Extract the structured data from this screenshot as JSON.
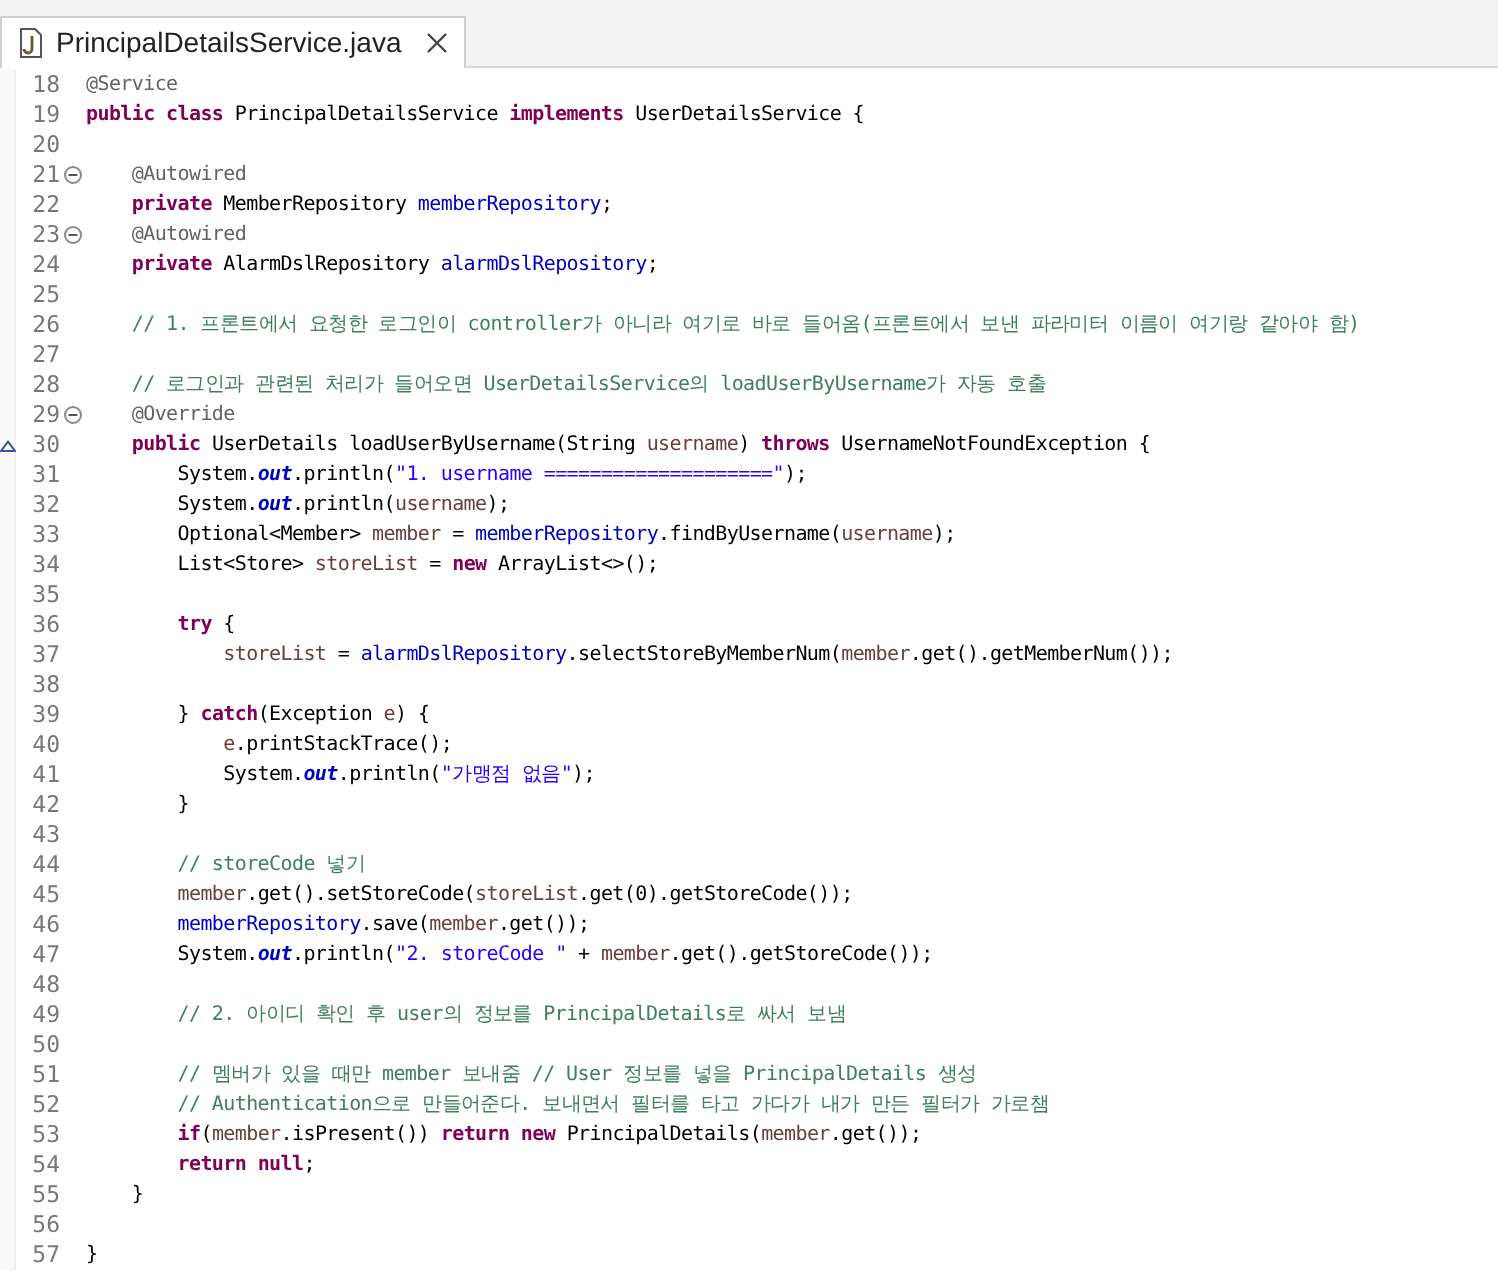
{
  "tabs": [
    {
      "label": "PrincipalDetailsService.java",
      "selected": true
    }
  ],
  "editor": {
    "lines": [
      {
        "num": "18",
        "tokens": [
          {
            "kind": "annotation",
            "text": "@Service"
          }
        ]
      },
      {
        "num": "19",
        "tokens": [
          {
            "kind": "keyword",
            "text": "public"
          },
          {
            "kind": "keyword",
            "text": " class"
          },
          {
            "kind": "plain",
            "text": " PrincipalDetailsService "
          },
          {
            "kind": "keyword",
            "text": "implements"
          },
          {
            "kind": "plain",
            "text": " UserDetailsService {"
          }
        ]
      },
      {
        "num": "20"
      },
      {
        "num": "21",
        "collapsible": true,
        "tokens": [
          {
            "kind": "annotation",
            "text": "    @Autowired"
          }
        ]
      },
      {
        "num": "22",
        "tokens": [
          {
            "kind": "keyword",
            "text": "    private"
          },
          {
            "kind": "plain",
            "text": " MemberRepository "
          },
          {
            "kind": "field",
            "text": "memberRepository"
          },
          {
            "kind": "plain",
            "text": ";"
          }
        ]
      },
      {
        "num": "23",
        "collapsible": true,
        "tokens": [
          {
            "kind": "annotation",
            "text": "    @Autowired"
          }
        ]
      },
      {
        "num": "24",
        "tokens": [
          {
            "kind": "keyword",
            "text": "    private"
          },
          {
            "kind": "plain",
            "text": " AlarmDslRepository "
          },
          {
            "kind": "field",
            "text": "alarmDslRepository"
          },
          {
            "kind": "plain",
            "text": ";"
          }
        ]
      },
      {
        "num": "25"
      },
      {
        "num": "26",
        "tokens": [
          {
            "kind": "comment",
            "text": "    // 1. 프론트에서 요청한 로그인이 controller가 아니라 여기로 바로 들어옴(프론트에서 보낸 파라미터 이름이 여기랑 같아야 함)"
          }
        ]
      },
      {
        "num": "27"
      },
      {
        "num": "28",
        "tokens": [
          {
            "kind": "comment",
            "text": "    // 로그인과 관련된 처리가 들어오면 UserDetailsService의 loadUserByUsername가 자동 호출"
          }
        ]
      },
      {
        "num": "29",
        "collapsible": true,
        "tokens": [
          {
            "kind": "annotation",
            "text": "    @Override"
          }
        ]
      },
      {
        "num": "30",
        "overrides": true,
        "tokens": [
          {
            "kind": "keyword",
            "text": "    public"
          },
          {
            "kind": "plain",
            "text": " UserDetails loadUserByUsername(String "
          },
          {
            "kind": "local",
            "text": "username"
          },
          {
            "kind": "plain",
            "text": ") "
          },
          {
            "kind": "keyword",
            "text": "throws"
          },
          {
            "kind": "plain",
            "text": " UsernameNotFoundException {"
          }
        ]
      },
      {
        "num": "31",
        "tokens": [
          {
            "kind": "plain",
            "text": "        System."
          },
          {
            "kind": "static",
            "text": "out"
          },
          {
            "kind": "plain",
            "text": ".println("
          },
          {
            "kind": "string",
            "text": "\"1. username ====================\""
          },
          {
            "kind": "plain",
            "text": ");"
          }
        ]
      },
      {
        "num": "32",
        "tokens": [
          {
            "kind": "plain",
            "text": "        System."
          },
          {
            "kind": "static",
            "text": "out"
          },
          {
            "kind": "plain",
            "text": ".println("
          },
          {
            "kind": "local",
            "text": "username"
          },
          {
            "kind": "plain",
            "text": ");"
          }
        ]
      },
      {
        "num": "33",
        "tokens": [
          {
            "kind": "plain",
            "text": "        Optional<Member> "
          },
          {
            "kind": "local",
            "text": "member"
          },
          {
            "kind": "plain",
            "text": " = "
          },
          {
            "kind": "field",
            "text": "memberRepository"
          },
          {
            "kind": "plain",
            "text": ".findByUsername("
          },
          {
            "kind": "local",
            "text": "username"
          },
          {
            "kind": "plain",
            "text": ");"
          }
        ]
      },
      {
        "num": "34",
        "tokens": [
          {
            "kind": "plain",
            "text": "        List<Store> "
          },
          {
            "kind": "local",
            "text": "storeList"
          },
          {
            "kind": "plain",
            "text": " = "
          },
          {
            "kind": "keyword",
            "text": "new"
          },
          {
            "kind": "plain",
            "text": " ArrayList<>();"
          }
        ]
      },
      {
        "num": "35"
      },
      {
        "num": "36",
        "tokens": [
          {
            "kind": "keyword",
            "text": "        try"
          },
          {
            "kind": "plain",
            "text": " {"
          }
        ]
      },
      {
        "num": "37",
        "tokens": [
          {
            "kind": "local",
            "text": "            storeList"
          },
          {
            "kind": "plain",
            "text": " = "
          },
          {
            "kind": "field",
            "text": "alarmDslRepository"
          },
          {
            "kind": "plain",
            "text": ".selectStoreByMemberNum("
          },
          {
            "kind": "local",
            "text": "member"
          },
          {
            "kind": "plain",
            "text": ".get().getMemberNum());"
          }
        ]
      },
      {
        "num": "38"
      },
      {
        "num": "39",
        "tokens": [
          {
            "kind": "plain",
            "text": "        } "
          },
          {
            "kind": "keyword",
            "text": "catch"
          },
          {
            "kind": "plain",
            "text": "(Exception "
          },
          {
            "kind": "local",
            "text": "e"
          },
          {
            "kind": "plain",
            "text": ") {"
          }
        ]
      },
      {
        "num": "40",
        "tokens": [
          {
            "kind": "local",
            "text": "            e"
          },
          {
            "kind": "plain",
            "text": ".printStackTrace();"
          }
        ]
      },
      {
        "num": "41",
        "tokens": [
          {
            "kind": "plain",
            "text": "            System."
          },
          {
            "kind": "static",
            "text": "out"
          },
          {
            "kind": "plain",
            "text": ".println("
          },
          {
            "kind": "string",
            "text": "\"가맹점 없음\""
          },
          {
            "kind": "plain",
            "text": ");"
          }
        ]
      },
      {
        "num": "42",
        "tokens": [
          {
            "kind": "plain",
            "text": "        }"
          }
        ]
      },
      {
        "num": "43"
      },
      {
        "num": "44",
        "tokens": [
          {
            "kind": "comment",
            "text": "        // storeCode 넣기"
          }
        ]
      },
      {
        "num": "45",
        "tokens": [
          {
            "kind": "local",
            "text": "        member"
          },
          {
            "kind": "plain",
            "text": ".get().setStoreCode("
          },
          {
            "kind": "local",
            "text": "storeList"
          },
          {
            "kind": "plain",
            "text": ".get(0).getStoreCode());"
          }
        ]
      },
      {
        "num": "46",
        "tokens": [
          {
            "kind": "field",
            "text": "        memberRepository"
          },
          {
            "kind": "plain",
            "text": ".save("
          },
          {
            "kind": "local",
            "text": "member"
          },
          {
            "kind": "plain",
            "text": ".get());"
          }
        ]
      },
      {
        "num": "47",
        "tokens": [
          {
            "kind": "plain",
            "text": "        System."
          },
          {
            "kind": "static",
            "text": "out"
          },
          {
            "kind": "plain",
            "text": ".println("
          },
          {
            "kind": "string",
            "text": "\"2. storeCode \""
          },
          {
            "kind": "plain",
            "text": " + "
          },
          {
            "kind": "local",
            "text": "member"
          },
          {
            "kind": "plain",
            "text": ".get().getStoreCode());"
          }
        ]
      },
      {
        "num": "48"
      },
      {
        "num": "49",
        "tokens": [
          {
            "kind": "comment",
            "text": "        // 2. 아이디 확인 후 user의 정보를 PrincipalDetails로 싸서 보냄"
          }
        ]
      },
      {
        "num": "50"
      },
      {
        "num": "51",
        "tokens": [
          {
            "kind": "comment",
            "text": "        // 멤버가 있을 때만 member 보내줌 // User 정보를 넣을 PrincipalDetails 생성"
          }
        ]
      },
      {
        "num": "52",
        "tokens": [
          {
            "kind": "comment",
            "text": "        // Authentication으로 만들어준다. 보내면서 필터를 타고 가다가 내가 만든 필터가 가로챔"
          }
        ]
      },
      {
        "num": "53",
        "tokens": [
          {
            "kind": "keyword",
            "text": "        if"
          },
          {
            "kind": "plain",
            "text": "("
          },
          {
            "kind": "local",
            "text": "member"
          },
          {
            "kind": "plain",
            "text": ".isPresent()) "
          },
          {
            "kind": "keyword",
            "text": "return"
          },
          {
            "kind": "keyword",
            "text": " new"
          },
          {
            "kind": "plain",
            "text": " PrincipalDetails("
          },
          {
            "kind": "local",
            "text": "member"
          },
          {
            "kind": "plain",
            "text": ".get());"
          }
        ]
      },
      {
        "num": "54",
        "tokens": [
          {
            "kind": "keyword",
            "text": "        return"
          },
          {
            "kind": "keyword",
            "text": " null"
          },
          {
            "kind": "plain",
            "text": ";"
          }
        ]
      },
      {
        "num": "55",
        "tokens": [
          {
            "kind": "plain",
            "text": "    }"
          }
        ]
      },
      {
        "num": "56"
      },
      {
        "num": "57",
        "tokens": [
          {
            "kind": "plain",
            "text": "}"
          }
        ]
      }
    ]
  }
}
